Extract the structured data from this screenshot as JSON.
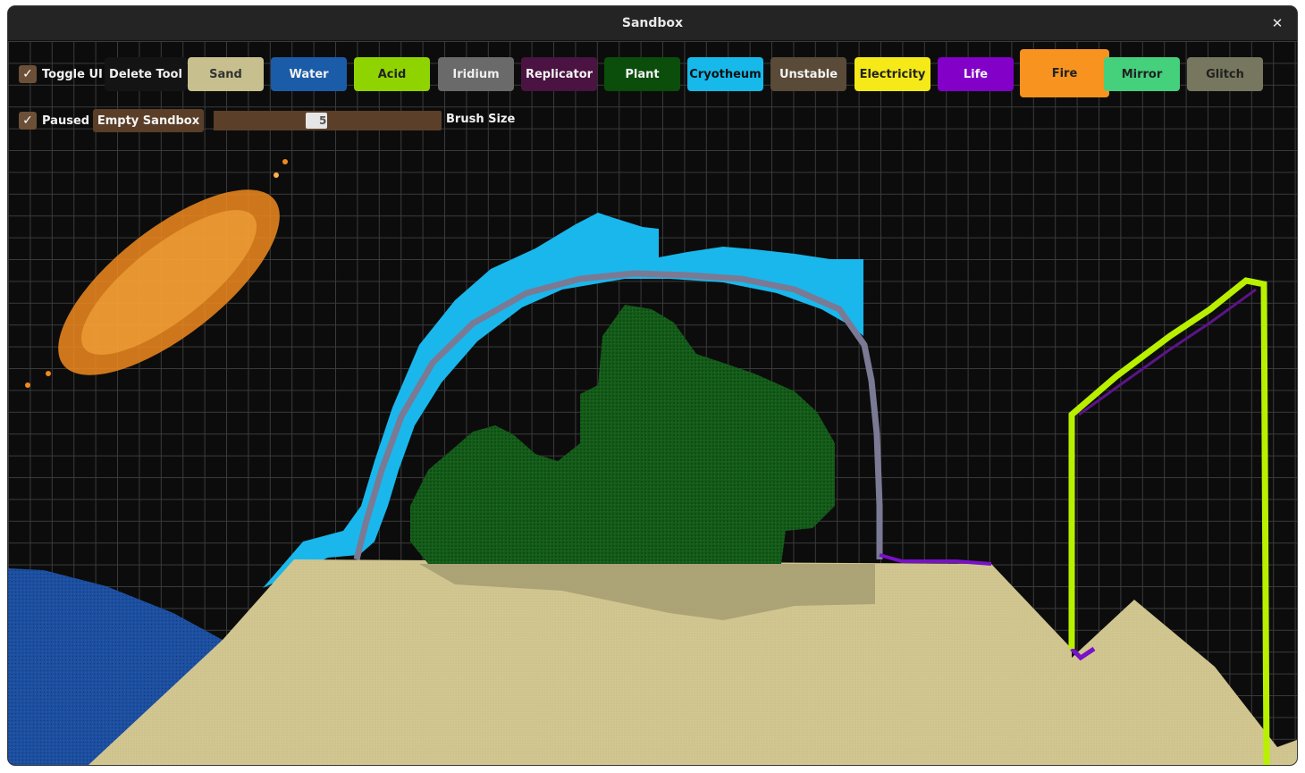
{
  "window": {
    "title": "Sandbox",
    "close_symbol": "✕"
  },
  "toggles": {
    "toggle_ui": {
      "label": "Toggle UI",
      "checked": true
    },
    "paused": {
      "label": "Paused",
      "checked": true
    }
  },
  "toolbar": {
    "delete_tool_label": "Delete Tool",
    "empty_sandbox_label": "Empty Sandbox",
    "brush_size_label": "Brush Size",
    "brush_size_value": "5",
    "brush_size_fraction": 0.45,
    "materials": [
      {
        "id": "sand",
        "label": "Sand",
        "bg": "#c7c08e",
        "fg": "#333333"
      },
      {
        "id": "water",
        "label": "Water",
        "bg": "#1b5ca8",
        "fg": "#f2f2f2"
      },
      {
        "id": "acid",
        "label": "Acid",
        "bg": "#8fd400",
        "fg": "#222222"
      },
      {
        "id": "iridium",
        "label": "Iridium",
        "bg": "#6a6a6a",
        "fg": "#eeeeee"
      },
      {
        "id": "replicator",
        "label": "Replicator",
        "bg": "#4a1342",
        "fg": "#f2f2f2"
      },
      {
        "id": "plant",
        "label": "Plant",
        "bg": "#0b4d0b",
        "fg": "#f2f2f2"
      },
      {
        "id": "cryotheum",
        "label": "Cryotheum",
        "bg": "#16b9ea",
        "fg": "#111111"
      },
      {
        "id": "unstable",
        "label": "Unstable",
        "bg": "#5a4a38",
        "fg": "#f2f2f2"
      },
      {
        "id": "electricity",
        "label": "Electricity",
        "bg": "#f5ea18",
        "fg": "#222222"
      },
      {
        "id": "life",
        "label": "Life",
        "bg": "#8200c8",
        "fg": "#f2f2f2"
      },
      {
        "id": "fire",
        "label": "Fire",
        "bg": "#f7931e",
        "fg": "#222222"
      },
      {
        "id": "mirror",
        "label": "Mirror",
        "bg": "#45d07c",
        "fg": "#222222"
      },
      {
        "id": "glitch",
        "label": "Glitch",
        "bg": "#77775f",
        "fg": "#222222"
      }
    ]
  },
  "colors": {
    "background": "#0c0c0c",
    "grid": "#3a3a3a",
    "sand": "#cfc48e",
    "water": "#1d4fa0",
    "cryotheum": "#1ab7ec",
    "iridium": "#7a7a95",
    "plant": "#155c1a",
    "fire": "#f08a1e",
    "electricity": "#b8f000",
    "life": "#7a10c8"
  }
}
